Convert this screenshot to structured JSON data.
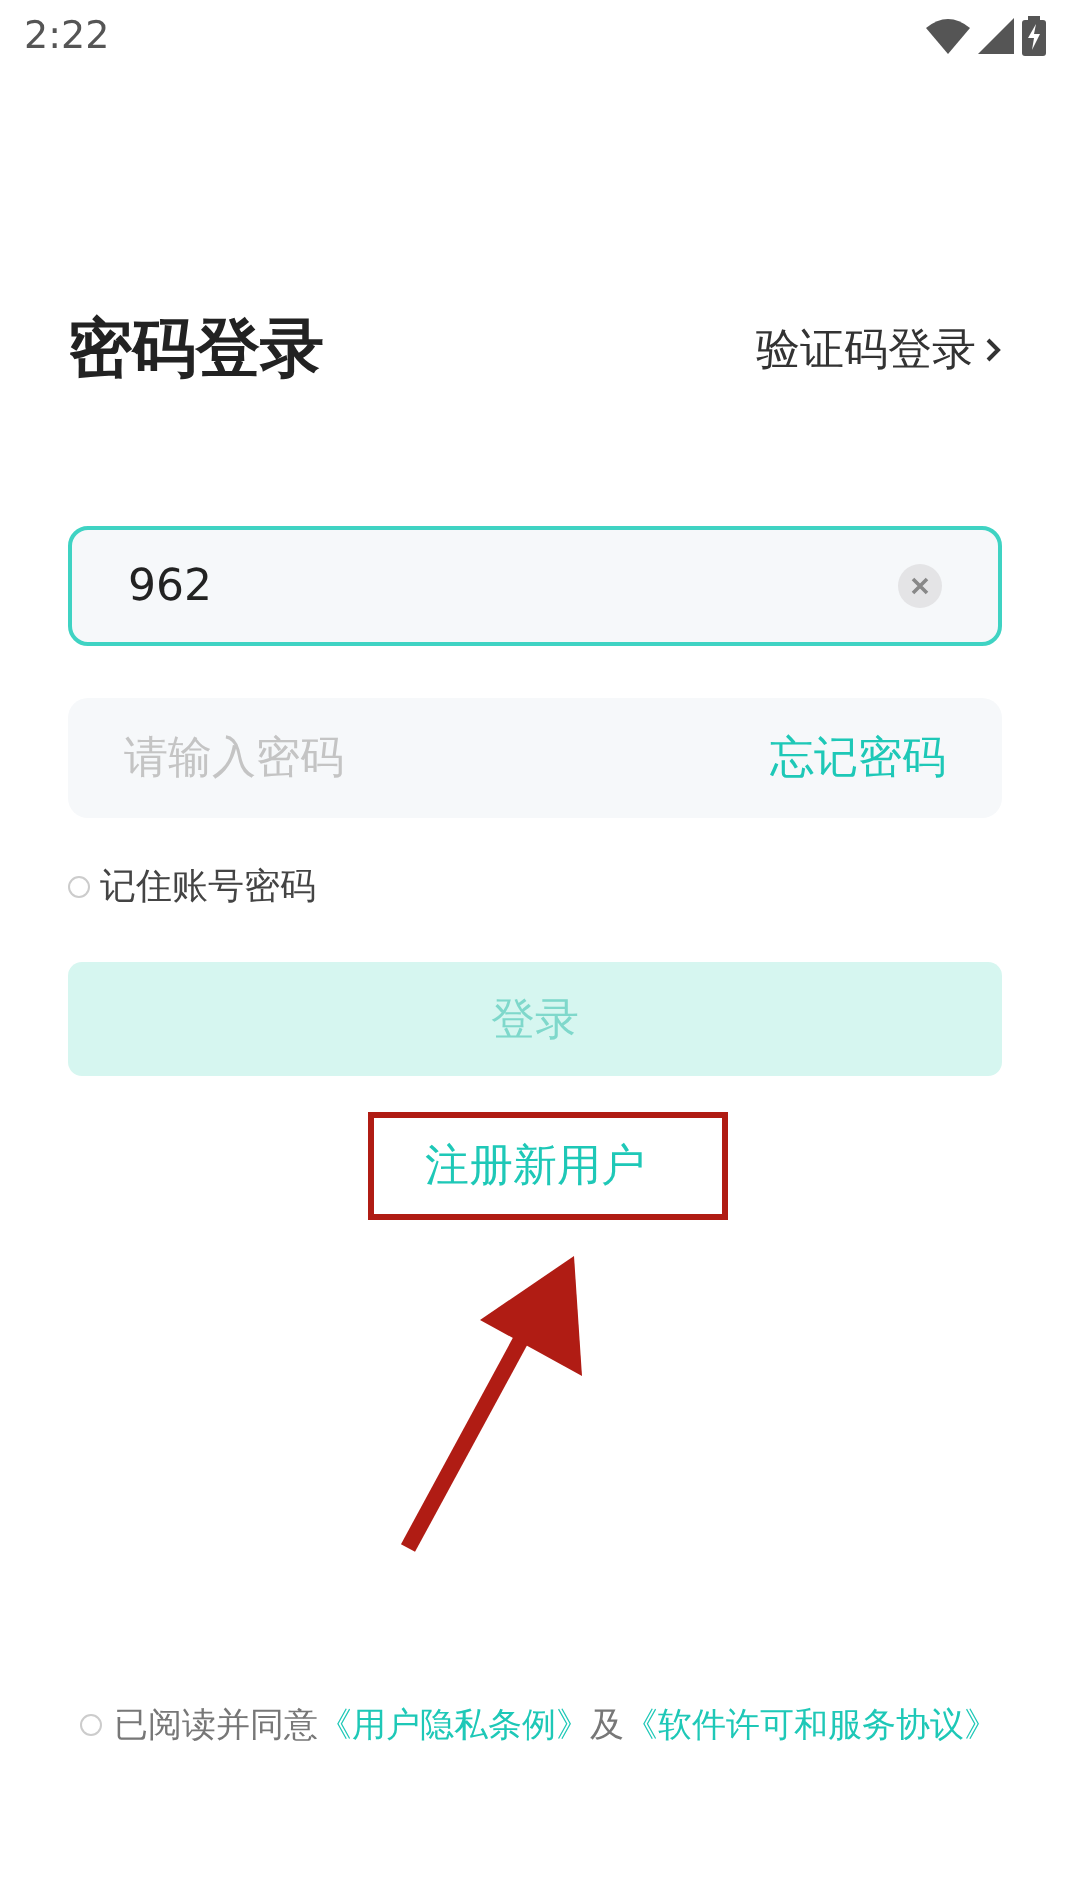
{
  "status_bar": {
    "time": "2:22"
  },
  "header": {
    "title": "密码登录",
    "switch_link": "验证码登录"
  },
  "account_field": {
    "value": "962",
    "focused": true
  },
  "password_field": {
    "placeholder": "请输入密码",
    "forgot_link": "忘记密码"
  },
  "remember": {
    "label": "记住账号密码",
    "checked": false
  },
  "login_button": {
    "label": "登录",
    "disabled": true
  },
  "register_link": "注册新用户",
  "agreement": {
    "checked": false,
    "prefix": "已阅读并同意",
    "links": [
      "《用户隐私条例》",
      "《软件许可和服务协议》"
    ],
    "joiner": "及"
  }
}
